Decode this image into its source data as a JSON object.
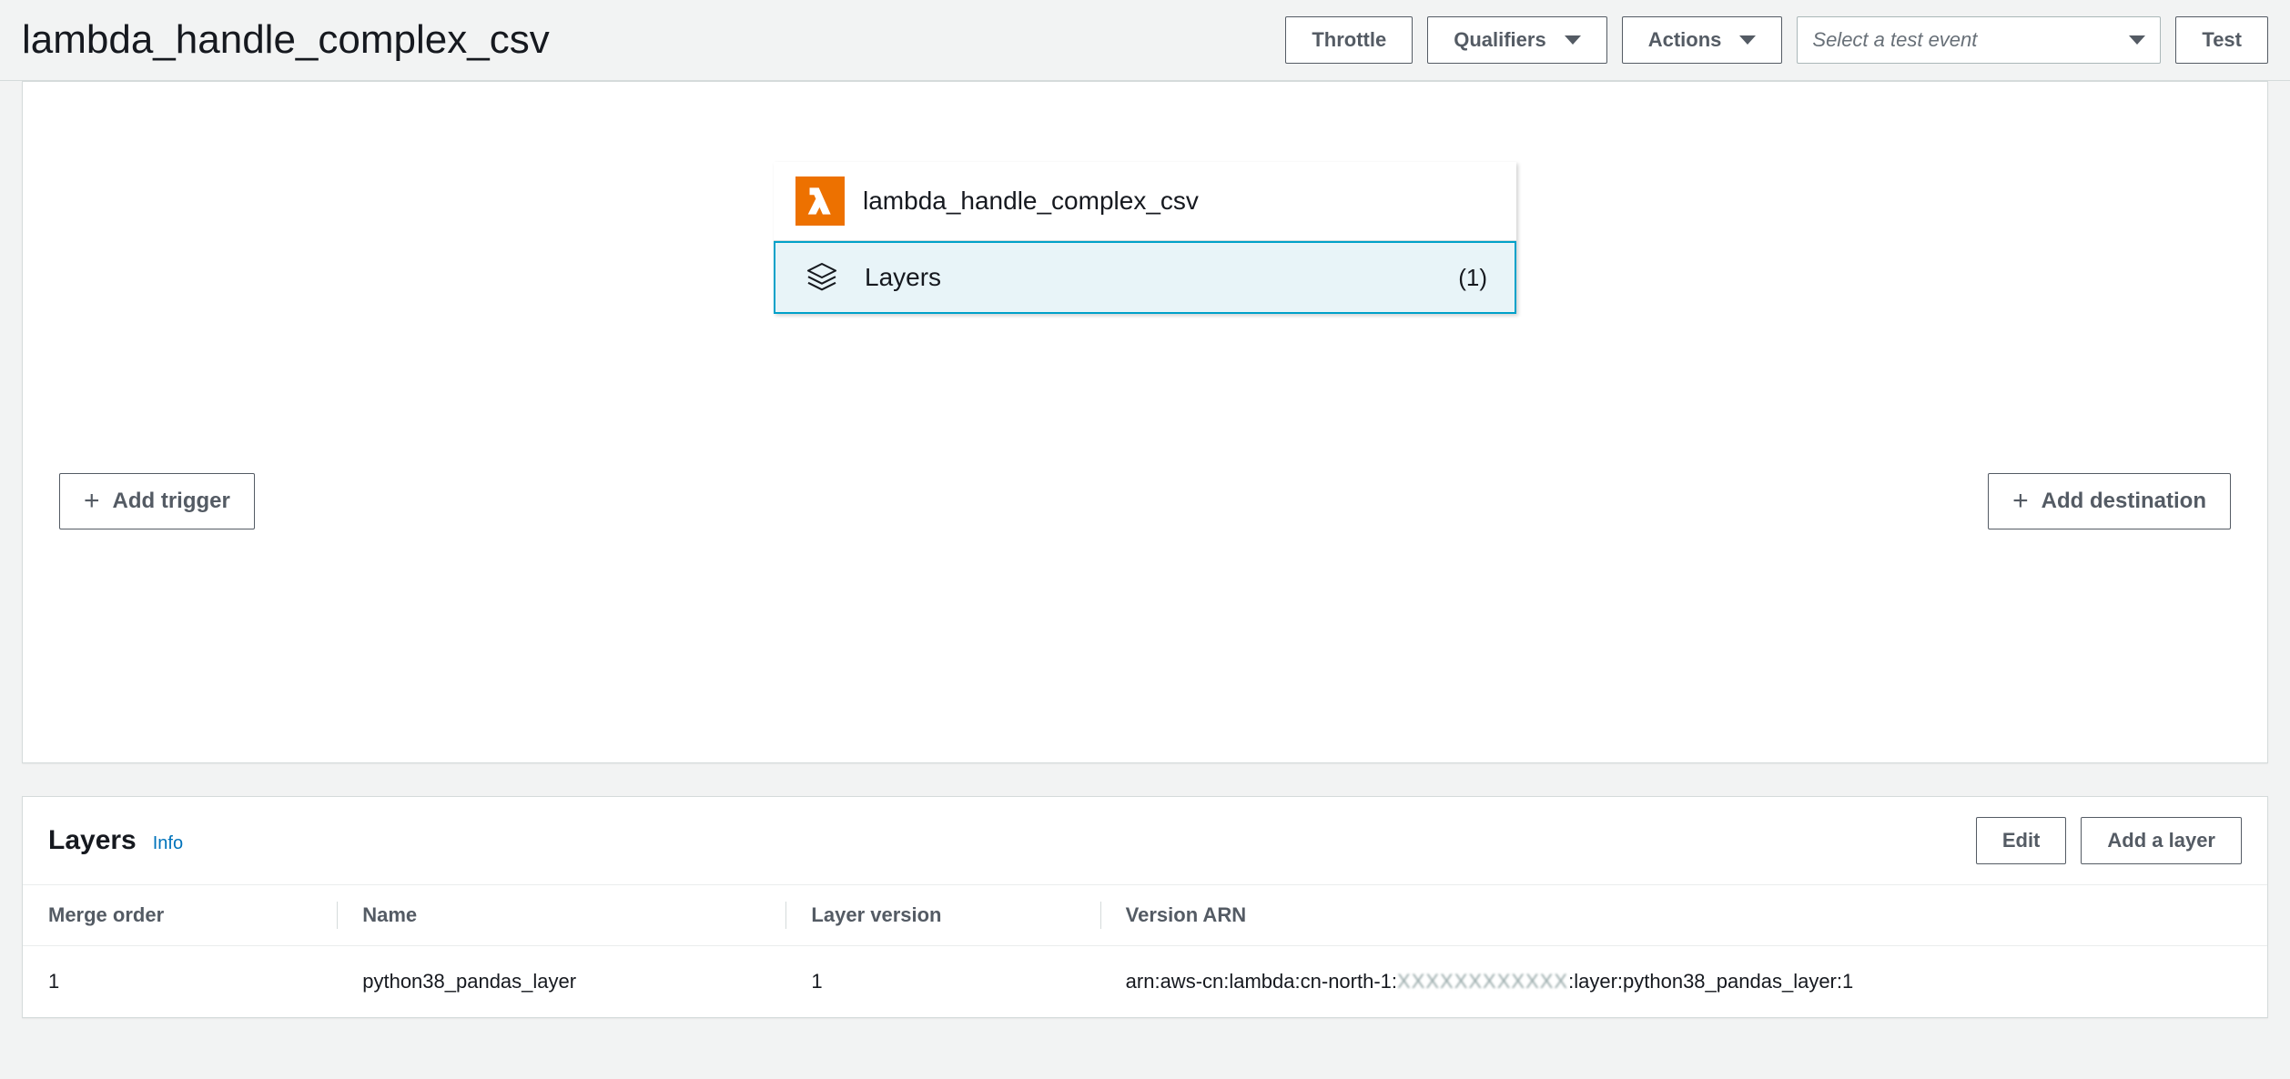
{
  "page_title": "lambda_handle_complex_csv",
  "header": {
    "throttle": "Throttle",
    "qualifiers": "Qualifiers",
    "actions": "Actions",
    "test_event_placeholder": "Select a test event",
    "test": "Test"
  },
  "designer": {
    "function_name": "lambda_handle_complex_csv",
    "layers_label": "Layers",
    "layers_count": "(1)",
    "add_trigger": "Add trigger",
    "add_destination": "Add destination"
  },
  "layers_panel": {
    "title": "Layers",
    "info": "Info",
    "edit": "Edit",
    "add_layer": "Add a layer",
    "columns": {
      "merge_order": "Merge order",
      "name": "Name",
      "version": "Layer version",
      "arn": "Version ARN"
    },
    "rows": [
      {
        "merge_order": "1",
        "name": "python38_pandas_layer",
        "version": "1",
        "arn_prefix": "arn:aws-cn:lambda:cn-north-1:",
        "arn_masked": "XXXXXXXXXXXX",
        "arn_suffix": ":layer:python38_pandas_layer:1"
      }
    ]
  }
}
